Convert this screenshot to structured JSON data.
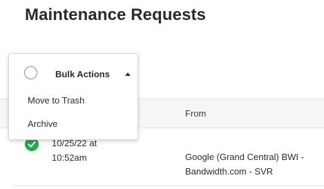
{
  "page": {
    "title": "Maintenance Requests"
  },
  "table": {
    "columns": {
      "from": "From"
    },
    "rows": [
      {
        "date_line1": "10/25/22 at",
        "date_line2": "10:52am",
        "from_line1": "Google (Grand Central) BWI -",
        "from_line2": "Bandwidth.com - SVR",
        "selected": true
      }
    ]
  },
  "bulk_actions": {
    "label": "Bulk Actions",
    "caret_icon": "caret-up-icon",
    "items": [
      {
        "label": "Move to Trash"
      },
      {
        "label": "Archive"
      }
    ]
  },
  "colors": {
    "check_green": "#22a84a",
    "text": "#2b2b2b",
    "header_bg": "#f6f6f6"
  }
}
